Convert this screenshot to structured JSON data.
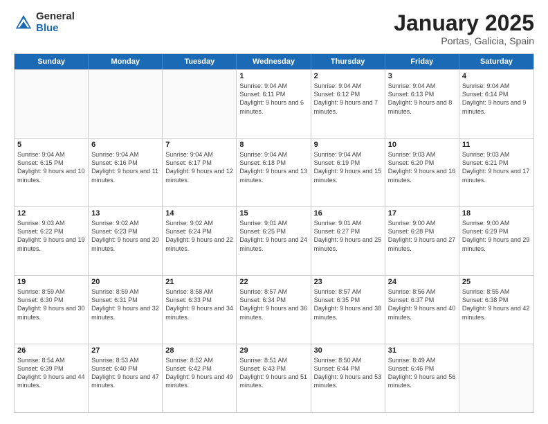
{
  "logo": {
    "general": "General",
    "blue": "Blue"
  },
  "title": "January 2025",
  "subtitle": "Portas, Galicia, Spain",
  "header_days": [
    "Sunday",
    "Monday",
    "Tuesday",
    "Wednesday",
    "Thursday",
    "Friday",
    "Saturday"
  ],
  "rows": [
    [
      {
        "day": "",
        "text": ""
      },
      {
        "day": "",
        "text": ""
      },
      {
        "day": "",
        "text": ""
      },
      {
        "day": "1",
        "text": "Sunrise: 9:04 AM\nSunset: 6:11 PM\nDaylight: 9 hours and 6 minutes."
      },
      {
        "day": "2",
        "text": "Sunrise: 9:04 AM\nSunset: 6:12 PM\nDaylight: 9 hours and 7 minutes."
      },
      {
        "day": "3",
        "text": "Sunrise: 9:04 AM\nSunset: 6:13 PM\nDaylight: 9 hours and 8 minutes."
      },
      {
        "day": "4",
        "text": "Sunrise: 9:04 AM\nSunset: 6:14 PM\nDaylight: 9 hours and 9 minutes."
      }
    ],
    [
      {
        "day": "5",
        "text": "Sunrise: 9:04 AM\nSunset: 6:15 PM\nDaylight: 9 hours and 10 minutes."
      },
      {
        "day": "6",
        "text": "Sunrise: 9:04 AM\nSunset: 6:16 PM\nDaylight: 9 hours and 11 minutes."
      },
      {
        "day": "7",
        "text": "Sunrise: 9:04 AM\nSunset: 6:17 PM\nDaylight: 9 hours and 12 minutes."
      },
      {
        "day": "8",
        "text": "Sunrise: 9:04 AM\nSunset: 6:18 PM\nDaylight: 9 hours and 13 minutes."
      },
      {
        "day": "9",
        "text": "Sunrise: 9:04 AM\nSunset: 6:19 PM\nDaylight: 9 hours and 15 minutes."
      },
      {
        "day": "10",
        "text": "Sunrise: 9:03 AM\nSunset: 6:20 PM\nDaylight: 9 hours and 16 minutes."
      },
      {
        "day": "11",
        "text": "Sunrise: 9:03 AM\nSunset: 6:21 PM\nDaylight: 9 hours and 17 minutes."
      }
    ],
    [
      {
        "day": "12",
        "text": "Sunrise: 9:03 AM\nSunset: 6:22 PM\nDaylight: 9 hours and 19 minutes."
      },
      {
        "day": "13",
        "text": "Sunrise: 9:02 AM\nSunset: 6:23 PM\nDaylight: 9 hours and 20 minutes."
      },
      {
        "day": "14",
        "text": "Sunrise: 9:02 AM\nSunset: 6:24 PM\nDaylight: 9 hours and 22 minutes."
      },
      {
        "day": "15",
        "text": "Sunrise: 9:01 AM\nSunset: 6:25 PM\nDaylight: 9 hours and 24 minutes."
      },
      {
        "day": "16",
        "text": "Sunrise: 9:01 AM\nSunset: 6:27 PM\nDaylight: 9 hours and 25 minutes."
      },
      {
        "day": "17",
        "text": "Sunrise: 9:00 AM\nSunset: 6:28 PM\nDaylight: 9 hours and 27 minutes."
      },
      {
        "day": "18",
        "text": "Sunrise: 9:00 AM\nSunset: 6:29 PM\nDaylight: 9 hours and 29 minutes."
      }
    ],
    [
      {
        "day": "19",
        "text": "Sunrise: 8:59 AM\nSunset: 6:30 PM\nDaylight: 9 hours and 30 minutes."
      },
      {
        "day": "20",
        "text": "Sunrise: 8:59 AM\nSunset: 6:31 PM\nDaylight: 9 hours and 32 minutes."
      },
      {
        "day": "21",
        "text": "Sunrise: 8:58 AM\nSunset: 6:33 PM\nDaylight: 9 hours and 34 minutes."
      },
      {
        "day": "22",
        "text": "Sunrise: 8:57 AM\nSunset: 6:34 PM\nDaylight: 9 hours and 36 minutes."
      },
      {
        "day": "23",
        "text": "Sunrise: 8:57 AM\nSunset: 6:35 PM\nDaylight: 9 hours and 38 minutes."
      },
      {
        "day": "24",
        "text": "Sunrise: 8:56 AM\nSunset: 6:37 PM\nDaylight: 9 hours and 40 minutes."
      },
      {
        "day": "25",
        "text": "Sunrise: 8:55 AM\nSunset: 6:38 PM\nDaylight: 9 hours and 42 minutes."
      }
    ],
    [
      {
        "day": "26",
        "text": "Sunrise: 8:54 AM\nSunset: 6:39 PM\nDaylight: 9 hours and 44 minutes."
      },
      {
        "day": "27",
        "text": "Sunrise: 8:53 AM\nSunset: 6:40 PM\nDaylight: 9 hours and 47 minutes."
      },
      {
        "day": "28",
        "text": "Sunrise: 8:52 AM\nSunset: 6:42 PM\nDaylight: 9 hours and 49 minutes."
      },
      {
        "day": "29",
        "text": "Sunrise: 8:51 AM\nSunset: 6:43 PM\nDaylight: 9 hours and 51 minutes."
      },
      {
        "day": "30",
        "text": "Sunrise: 8:50 AM\nSunset: 6:44 PM\nDaylight: 9 hours and 53 minutes."
      },
      {
        "day": "31",
        "text": "Sunrise: 8:49 AM\nSunset: 6:46 PM\nDaylight: 9 hours and 56 minutes."
      },
      {
        "day": "",
        "text": ""
      }
    ]
  ]
}
